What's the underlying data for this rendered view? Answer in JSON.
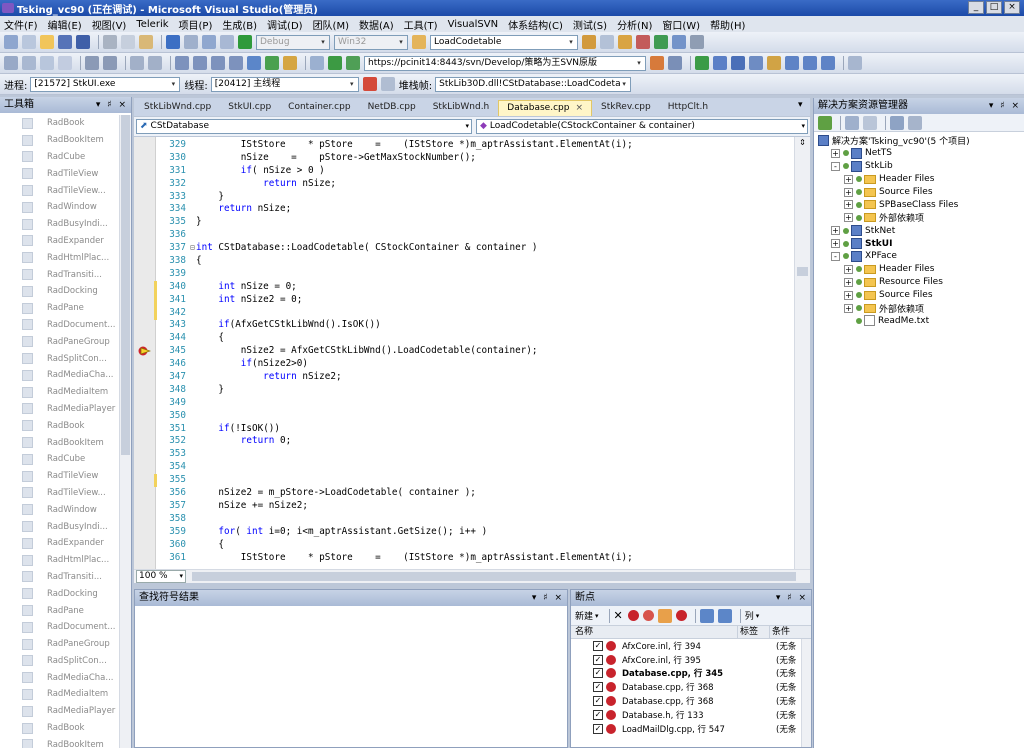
{
  "window": {
    "title": "Tsking_vc90 (正在调试) - Microsoft Visual Studio(管理员)",
    "buttons": [
      "_",
      "□",
      "×"
    ]
  },
  "menu": [
    "文件(F)",
    "编辑(E)",
    "视图(V)",
    "Telerik",
    "项目(P)",
    "生成(B)",
    "调试(D)",
    "团队(M)",
    "数据(A)",
    "工具(T)",
    "VisualSVN",
    "体系结构(C)",
    "测试(S)",
    "分析(N)",
    "窗口(W)",
    "帮助(H)"
  ],
  "toolbar1": {
    "config": "Debug",
    "platform": "Win32",
    "find_combo": "LoadCodetable"
  },
  "toolbar2": {
    "svn_url": "https://pcinit14:8443/svn/Develop/策略为王SVN原版"
  },
  "debugbar": {
    "process_label": "进程:",
    "process_value": "[21572] StkUI.exe",
    "thread_label": "线程:",
    "thread_value": "[20412] 主线程",
    "stack_label": "堆栈帧:",
    "stack_value": "StkLib30D.dll!CStDatabase::LoadCodeta"
  },
  "toolbox": {
    "title": "工具箱",
    "controls": "▾ ♯ ×",
    "items": [
      "RadBook",
      "RadBookItem",
      "RadCube",
      "RadTileView",
      "RadTileView...",
      "RadWindow",
      "RadBusyIndi...",
      "RadExpander",
      "RadHtmlPlac...",
      "RadTransiti...",
      "RadDocking",
      "RadPane",
      "RadDocument...",
      "RadPaneGroup",
      "RadSplitCon...",
      "RadMediaCha...",
      "RadMediaItem",
      "RadMediaPlayer",
      "RadBook",
      "RadBookItem",
      "RadCube",
      "RadTileView",
      "RadTileView...",
      "RadWindow",
      "RadBusyIndi...",
      "RadExpander",
      "RadHtmlPlac...",
      "RadTransiti...",
      "RadDocking",
      "RadPane",
      "RadDocument...",
      "RadPaneGroup",
      "RadSplitCon...",
      "RadMediaCha...",
      "RadMediaItem",
      "RadMediaPlayer",
      "RadBook",
      "RadBookItem"
    ]
  },
  "editor": {
    "tabs": [
      "StkLibWnd.cpp",
      "StkUI.cpp",
      "Container.cpp",
      "NetDB.cpp",
      "StkLibWnd.h",
      "Database.cpp",
      "StkRev.cpp",
      "HttpClt.h"
    ],
    "active_tab": "Database.cpp",
    "tab_close": "×",
    "tab_dropdown": "▾",
    "class_combo": "CStDatabase",
    "member_combo": "LoadCodetable(CStockContainer & container)",
    "zoom": "100 %",
    "lines": [
      {
        "n": "329",
        "indent": "        ",
        "code": "IStStore    * pStore    =    (IStStore *)m_aptrAssistant.ElementAt(i);",
        "chg": false
      },
      {
        "n": "330",
        "indent": "        ",
        "code": "nSize    =    pStore->GetMaxStockNumber();",
        "chg": false
      },
      {
        "n": "331",
        "indent": "        ",
        "code": "if( nSize > 0 )",
        "chg": false
      },
      {
        "n": "332",
        "indent": "            ",
        "code": "return nSize;",
        "chg": false
      },
      {
        "n": "333",
        "indent": "    ",
        "code": "}",
        "chg": false
      },
      {
        "n": "334",
        "indent": "    ",
        "code": "return nSize;",
        "chg": false
      },
      {
        "n": "335",
        "indent": "",
        "code": "}",
        "chg": false
      },
      {
        "n": "336",
        "indent": "",
        "code": "",
        "chg": false
      },
      {
        "n": "337",
        "indent": "",
        "code": "int CStDatabase::LoadCodetable( CStockContainer & container )",
        "chg": false,
        "fold": true
      },
      {
        "n": "338",
        "indent": "",
        "code": "{",
        "chg": false
      },
      {
        "n": "339",
        "indent": "",
        "code": "",
        "chg": false
      },
      {
        "n": "340",
        "indent": "    ",
        "code": "int nSize = 0;",
        "chg": true
      },
      {
        "n": "341",
        "indent": "    ",
        "code": "int nSize2 = 0;",
        "chg": true
      },
      {
        "n": "342",
        "indent": "",
        "code": "",
        "chg": true
      },
      {
        "n": "343",
        "indent": "    ",
        "code": "if(AfxGetCStkLibWnd().IsOK())",
        "chg": false
      },
      {
        "n": "344",
        "indent": "    ",
        "code": "{",
        "chg": false
      },
      {
        "n": "345",
        "indent": "        ",
        "code": "nSize2 = AfxGetCStkLibWnd().LoadCodetable(container);",
        "chg": false,
        "exec": true
      },
      {
        "n": "346",
        "indent": "        ",
        "code": "if(nSize2>0)",
        "chg": false
      },
      {
        "n": "347",
        "indent": "            ",
        "code": "return nSize2;",
        "chg": false
      },
      {
        "n": "348",
        "indent": "    ",
        "code": "}",
        "chg": false
      },
      {
        "n": "349",
        "indent": "",
        "code": "",
        "chg": false
      },
      {
        "n": "350",
        "indent": "",
        "code": "",
        "chg": false
      },
      {
        "n": "351",
        "indent": "    ",
        "code": "if(!IsOK())",
        "chg": false
      },
      {
        "n": "352",
        "indent": "        ",
        "code": "return 0;",
        "chg": false
      },
      {
        "n": "353",
        "indent": "",
        "code": "",
        "chg": false
      },
      {
        "n": "354",
        "indent": "",
        "code": "",
        "chg": false
      },
      {
        "n": "355",
        "indent": "",
        "code": "",
        "chg": true
      },
      {
        "n": "356",
        "indent": "    ",
        "code": "nSize2 = m_pStore->LoadCodetable( container );",
        "chg": false
      },
      {
        "n": "357",
        "indent": "    ",
        "code": "nSize += nSize2;",
        "chg": false
      },
      {
        "n": "358",
        "indent": "",
        "code": "",
        "chg": false
      },
      {
        "n": "359",
        "indent": "    ",
        "code": "for( int i=0; i<m_aptrAssistant.GetSize(); i++ )",
        "chg": false
      },
      {
        "n": "360",
        "indent": "    ",
        "code": "{",
        "chg": false
      },
      {
        "n": "361",
        "indent": "        ",
        "code": "IStStore    * pStore    =    (IStStore *)m_aptrAssistant.ElementAt(i);",
        "chg": false
      }
    ]
  },
  "find_results": {
    "title": "查找符号结果",
    "controls": "▾ ♯ ×"
  },
  "breakpoints": {
    "title": "断点",
    "controls": "▾ ♯ ×",
    "new_label": "新建",
    "columns_label": "列",
    "col_name": "名称",
    "col_label": "标签",
    "col_condition": "条件",
    "rows": [
      {
        "name": "AfxCore.inl, 行 394",
        "cond": "(无条",
        "bold": false
      },
      {
        "name": "AfxCore.inl, 行 395",
        "cond": "(无条",
        "bold": false
      },
      {
        "name": "Database.cpp, 行 345",
        "cond": "(无条",
        "bold": true
      },
      {
        "name": "Database.cpp, 行 368",
        "cond": "(无条",
        "bold": false
      },
      {
        "name": "Database.cpp, 行 368",
        "cond": "(无条",
        "bold": false
      },
      {
        "name": "Database.h, 行 133",
        "cond": "(无条",
        "bold": false
      },
      {
        "name": "LoadMailDlg.cpp, 行 547",
        "cond": "(无条",
        "bold": false
      }
    ]
  },
  "solution": {
    "title": "解决方案资源管理器",
    "controls": "▾ ♯ ×",
    "nodes": [
      {
        "label": "解决方案'Tsking_vc90'(5 个项目)",
        "level": 0,
        "type": "solution",
        "exp": "",
        "bold": false
      },
      {
        "label": "NetTS",
        "level": 1,
        "type": "project",
        "exp": "+",
        "bold": false
      },
      {
        "label": "StkLib",
        "level": 1,
        "type": "project",
        "exp": "-",
        "bold": false
      },
      {
        "label": "Header Files",
        "level": 2,
        "type": "folder",
        "exp": "+",
        "bold": false
      },
      {
        "label": "Source Files",
        "level": 2,
        "type": "folder",
        "exp": "+",
        "bold": false
      },
      {
        "label": "SPBaseClass Files",
        "level": 2,
        "type": "folder",
        "exp": "+",
        "bold": false
      },
      {
        "label": "外部依赖项",
        "level": 2,
        "type": "folder",
        "exp": "+",
        "bold": false
      },
      {
        "label": "StkNet",
        "level": 1,
        "type": "project",
        "exp": "+",
        "bold": false
      },
      {
        "label": "StkUI",
        "level": 1,
        "type": "project",
        "exp": "+",
        "bold": true
      },
      {
        "label": "XPFace",
        "level": 1,
        "type": "project",
        "exp": "-",
        "bold": false
      },
      {
        "label": "Header Files",
        "level": 2,
        "type": "folder",
        "exp": "+",
        "bold": false
      },
      {
        "label": "Resource Files",
        "level": 2,
        "type": "folder",
        "exp": "+",
        "bold": false
      },
      {
        "label": "Source Files",
        "level": 2,
        "type": "folder",
        "exp": "+",
        "bold": false
      },
      {
        "label": "外部依赖项",
        "level": 2,
        "type": "folder",
        "exp": "+",
        "bold": false
      },
      {
        "label": "ReadMe.txt",
        "level": 2,
        "type": "file",
        "exp": "",
        "bold": false
      }
    ]
  }
}
